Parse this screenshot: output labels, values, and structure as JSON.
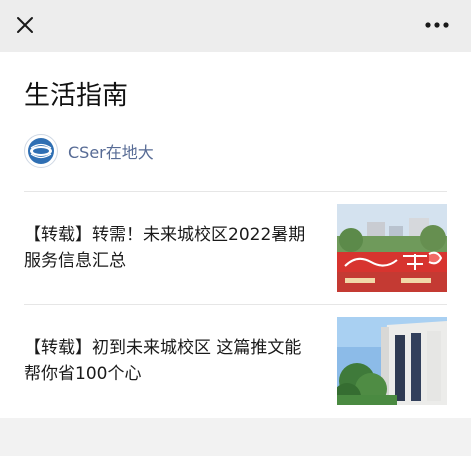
{
  "topbar": {
    "close_icon": "close-icon",
    "more_icon": "more-horizontal-icon"
  },
  "page": {
    "title": "生活指南"
  },
  "account": {
    "name": "CSer在地大",
    "avatar_icon": "account-logo-icon"
  },
  "articles": [
    {
      "title": "【转载】转需！未来城校区2022暑期服务信息汇总",
      "thumbnail": "campus-sign-thumbnail"
    },
    {
      "title": "【转载】初到未来城校区 这篇推文能帮你省100个心",
      "thumbnail": "building-thumbnail"
    }
  ],
  "colors": {
    "topbar_bg": "#ededed",
    "account_link": "#576b95",
    "page_bg": "#f2f2f2"
  }
}
